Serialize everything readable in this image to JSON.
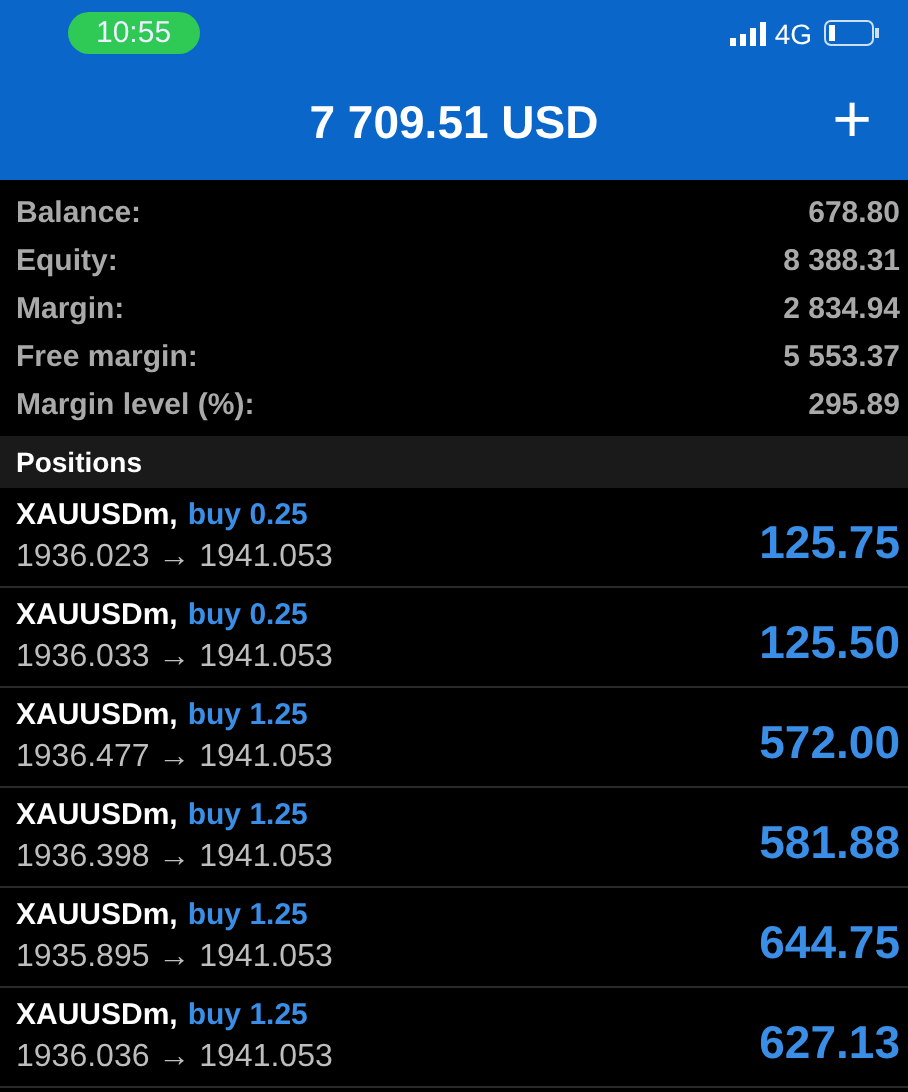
{
  "status_bar": {
    "time": "10:55",
    "network": "4G"
  },
  "header": {
    "title": "7 709.51 USD",
    "add_button": "+"
  },
  "summary": [
    {
      "label": "Balance:",
      "value": "678.80"
    },
    {
      "label": "Equity:",
      "value": "8 388.31"
    },
    {
      "label": "Margin:",
      "value": "2 834.94"
    },
    {
      "label": "Free margin:",
      "value": "5 553.37"
    },
    {
      "label": "Margin level (%):",
      "value": "295.89"
    }
  ],
  "positions_title": "Positions",
  "positions": [
    {
      "symbol": "XAUUSDm,",
      "order": "buy 0.25",
      "prices": "1936.023 → 1941.053",
      "profit": "125.75"
    },
    {
      "symbol": "XAUUSDm,",
      "order": "buy 0.25",
      "prices": "1936.033 → 1941.053",
      "profit": "125.50"
    },
    {
      "symbol": "XAUUSDm,",
      "order": "buy 1.25",
      "prices": "1936.477 → 1941.053",
      "profit": "572.00"
    },
    {
      "symbol": "XAUUSDm,",
      "order": "buy 1.25",
      "prices": "1936.398 → 1941.053",
      "profit": "581.88"
    },
    {
      "symbol": "XAUUSDm,",
      "order": "buy 1.25",
      "prices": "1935.895 → 1941.053",
      "profit": "644.75"
    },
    {
      "symbol": "XAUUSDm,",
      "order": "buy 1.25",
      "prices": "1936.036 → 1941.053",
      "profit": "627.13"
    }
  ]
}
